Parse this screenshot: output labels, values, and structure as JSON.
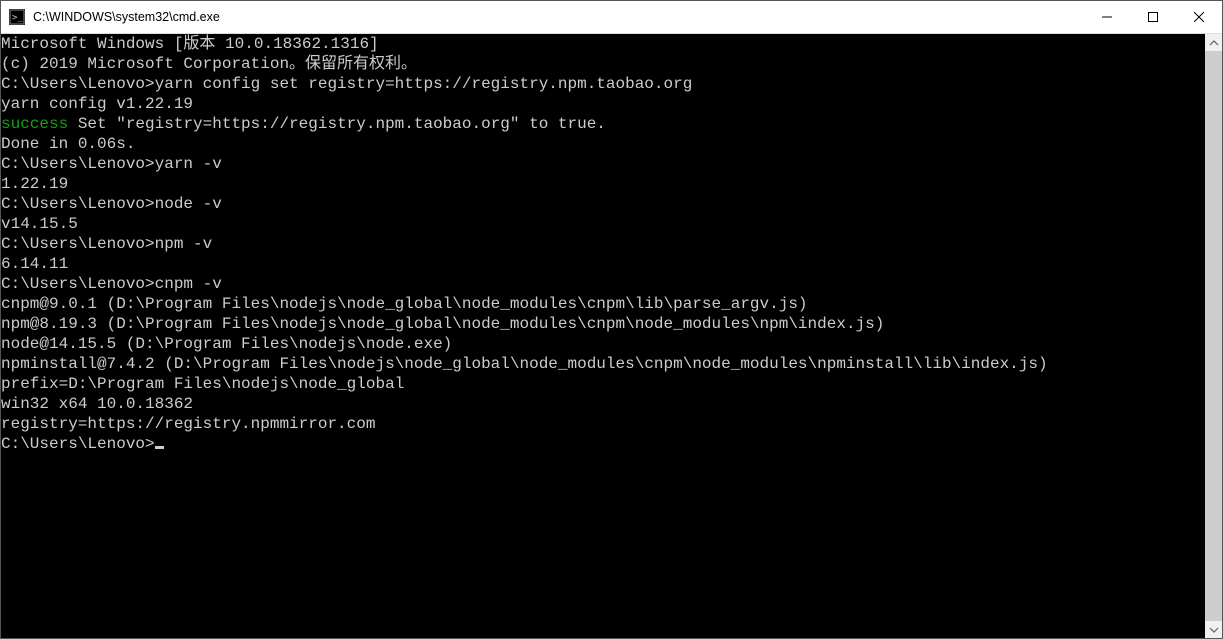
{
  "titlebar": {
    "title": "C:\\WINDOWS\\system32\\cmd.exe"
  },
  "lines": {
    "l0": "Microsoft Windows [版本 10.0.18362.1316]",
    "l1": "(c) 2019 Microsoft Corporation。保留所有权利。",
    "l2": "",
    "l3p": "C:\\Users\\Lenovo>",
    "l3c": "yarn config set registry=https://registry.npm.taobao.org",
    "l4": "yarn config v1.22.19",
    "l5a": "success",
    "l5b": " Set \"registry=https://registry.npm.taobao.org\" to true.",
    "l6": "Done in 0.06s.",
    "l7": "",
    "l8p": "C:\\Users\\Lenovo>",
    "l8c": "yarn -v",
    "l9": "1.22.19",
    "l10": "",
    "l11p": "C:\\Users\\Lenovo>",
    "l11c": "node -v",
    "l12": "v14.15.5",
    "l13": "",
    "l14p": "C:\\Users\\Lenovo>",
    "l14c": "npm -v",
    "l15": "6.14.11",
    "l16": "",
    "l17p": "C:\\Users\\Lenovo>",
    "l17c": "cnpm -v",
    "l18": "cnpm@9.0.1 (D:\\Program Files\\nodejs\\node_global\\node_modules\\cnpm\\lib\\parse_argv.js)",
    "l19": "npm@8.19.3 (D:\\Program Files\\nodejs\\node_global\\node_modules\\cnpm\\node_modules\\npm\\index.js)",
    "l20": "node@14.15.5 (D:\\Program Files\\nodejs\\node.exe)",
    "l21": "npminstall@7.4.2 (D:\\Program Files\\nodejs\\node_global\\node_modules\\cnpm\\node_modules\\npminstall\\lib\\index.js)",
    "l22": "prefix=D:\\Program Files\\nodejs\\node_global",
    "l23": "win32 x64 10.0.18362",
    "l24": "registry=https://registry.npmmirror.com",
    "l25": "",
    "l26p": "C:\\Users\\Lenovo>"
  }
}
